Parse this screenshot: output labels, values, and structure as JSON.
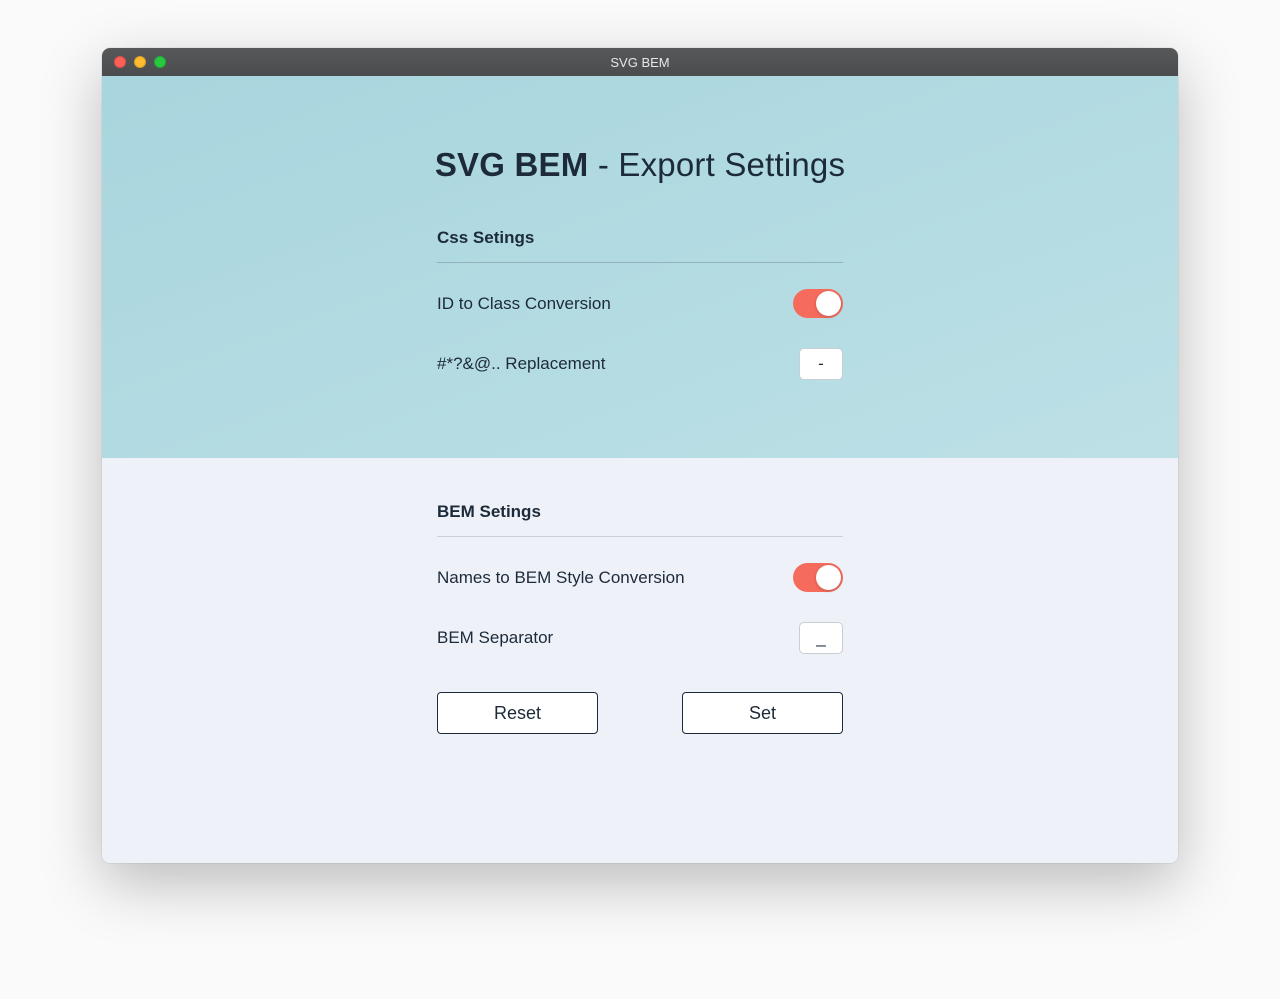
{
  "window": {
    "title": "SVG BEM"
  },
  "header": {
    "title_strong": "SVG BEM",
    "title_rest": "- Export Settings"
  },
  "css_section": {
    "heading": "Css Setings",
    "items": [
      {
        "label": "ID to Class Conversion",
        "toggle_on": true
      },
      {
        "label": "#*?&@.. Replacement",
        "input_value": "-"
      }
    ]
  },
  "bem_section": {
    "heading": "BEM Setings",
    "items": [
      {
        "label": "Names to BEM Style Conversion",
        "toggle_on": true
      },
      {
        "label": "BEM Separator",
        "input_value": "_"
      }
    ]
  },
  "buttons": {
    "reset": "Reset",
    "set": "Set"
  },
  "colors": {
    "accent": "#f56b5c",
    "hero_bg_from": "#a8d5de",
    "hero_bg_to": "#bde0e6",
    "lower_bg": "#eef1f8",
    "text": "#1c2a3a"
  }
}
